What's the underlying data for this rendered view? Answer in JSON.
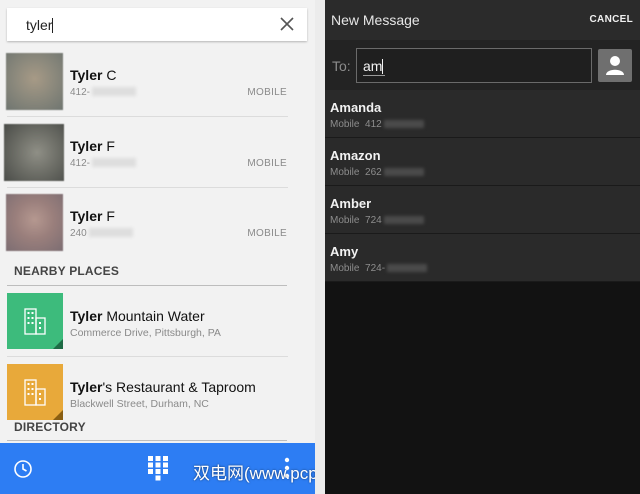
{
  "left_panel": {
    "search": {
      "value": "tyler"
    },
    "contacts": [
      {
        "name_bold": "Tyler",
        "name_rest": " C",
        "number": "412-",
        "type": "MOBILE"
      },
      {
        "name_bold": "Tyler",
        "name_rest": " F",
        "number": "412-",
        "type": "MOBILE"
      },
      {
        "name_bold": "Tyler",
        "name_rest": " F",
        "number": "240",
        "type": "MOBILE"
      }
    ],
    "nearby_header": "NEARBY PLACES",
    "places": [
      {
        "name_bold": "Tyler",
        "name_rest": " Mountain Water",
        "address": "Commerce Drive, Pittsburgh, PA",
        "color": "#3dbb7c"
      },
      {
        "name_bold": "Tyler",
        "name_rest": "'s Restaurant & Taproom",
        "address": "Blackwell Street, Durham, NC",
        "color": "#e8a93a"
      }
    ],
    "directory_header": "DIRECTORY",
    "bottom_bar": {
      "color": "#2d7df3",
      "icons": [
        "clock-icon",
        "dialpad-icon",
        "more-vert-icon"
      ]
    }
  },
  "watermark": "双电网(www.pcpc.me)",
  "right_panel": {
    "title": "New Message",
    "cancel": "CANCEL",
    "to_label": "To:",
    "to_value": "am",
    "suggestions": [
      {
        "name": "Amanda",
        "type": "Mobile",
        "number": "412"
      },
      {
        "name": "Amazon",
        "type": "Mobile",
        "number": "262"
      },
      {
        "name": "Amber",
        "type": "Mobile",
        "number": "724"
      },
      {
        "name": "Amy",
        "type": "Mobile",
        "number": "724-"
      }
    ]
  }
}
